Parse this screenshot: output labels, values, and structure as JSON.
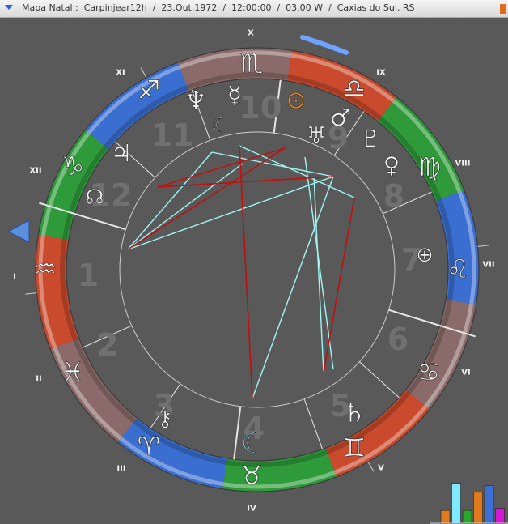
{
  "window": {
    "title": "Mapa Natal :  Carpinjear12h  /  23.Out.1972  /  12:00:00  /  03.00 W  /  Caxias do Sul. RS"
  },
  "colors": {
    "fire": "#c94a2d",
    "earth": "#8a6a6a",
    "air": "#3a6ed0",
    "water": "#2e9a3a",
    "aspect_red": "#c01010",
    "aspect_cyan": "#9ff6f4",
    "sun": "#e8851e",
    "moon": "#9ff0ff"
  },
  "zodiac": [
    {
      "sign": "Aries",
      "glyph": "♈",
      "element": "fire"
    },
    {
      "sign": "Taurus",
      "glyph": "♉",
      "element": "earth"
    },
    {
      "sign": "Gemini",
      "glyph": "♊",
      "element": "air"
    },
    {
      "sign": "Cancer",
      "glyph": "♋",
      "element": "water"
    },
    {
      "sign": "Leo",
      "glyph": "♌",
      "element": "fire"
    },
    {
      "sign": "Virgo",
      "glyph": "♍",
      "element": "earth"
    },
    {
      "sign": "Libra",
      "glyph": "♎",
      "element": "air"
    },
    {
      "sign": "Scorpio",
      "glyph": "♏",
      "element": "water"
    },
    {
      "sign": "Sagittarius",
      "glyph": "♐",
      "element": "fire"
    },
    {
      "sign": "Capricorn",
      "glyph": "♑",
      "element": "earth"
    },
    {
      "sign": "Aquarius",
      "glyph": "♒",
      "element": "air"
    },
    {
      "sign": "Pisces",
      "glyph": "♓",
      "element": "water"
    }
  ],
  "houses_arabic": [
    "1",
    "2",
    "3",
    "4",
    "5",
    "6",
    "7",
    "8",
    "9",
    "10",
    "11",
    "12"
  ],
  "houses_roman": [
    "I",
    "II",
    "III",
    "IV",
    "V",
    "VI",
    "VII",
    "VIII",
    "IX",
    "X",
    "XI",
    "XII"
  ],
  "planets": [
    {
      "name": "Sun",
      "glyph": "⊙"
    },
    {
      "name": "Moon",
      "glyph": "☾"
    },
    {
      "name": "Mercury",
      "glyph": "☿"
    },
    {
      "name": "Venus",
      "glyph": "♀"
    },
    {
      "name": "Mars",
      "glyph": "♂"
    },
    {
      "name": "Jupiter",
      "glyph": "♃"
    },
    {
      "name": "Saturn",
      "glyph": "♄"
    },
    {
      "name": "Uranus",
      "glyph": "♅"
    },
    {
      "name": "Neptune",
      "glyph": "♆"
    },
    {
      "name": "Pluto",
      "glyph": "♇"
    },
    {
      "name": "Chiron",
      "glyph": "⚷"
    },
    {
      "name": "North Node",
      "glyph": "☊"
    },
    {
      "name": "Part of Fortune",
      "glyph": "⊕"
    },
    {
      "name": "Moon (house 4)",
      "glyph": "☾"
    }
  ],
  "histogram": [
    {
      "value": 0.3,
      "color": "#e07a1c"
    },
    {
      "value": 0.9,
      "color": "#7fe9ff"
    },
    {
      "value": 0.3,
      "color": "#2aa62a"
    },
    {
      "value": 0.7,
      "color": "#e07a1c"
    },
    {
      "value": 0.85,
      "color": "#3b6fd6"
    },
    {
      "value": 0.35,
      "color": "#d21ad2"
    }
  ]
}
